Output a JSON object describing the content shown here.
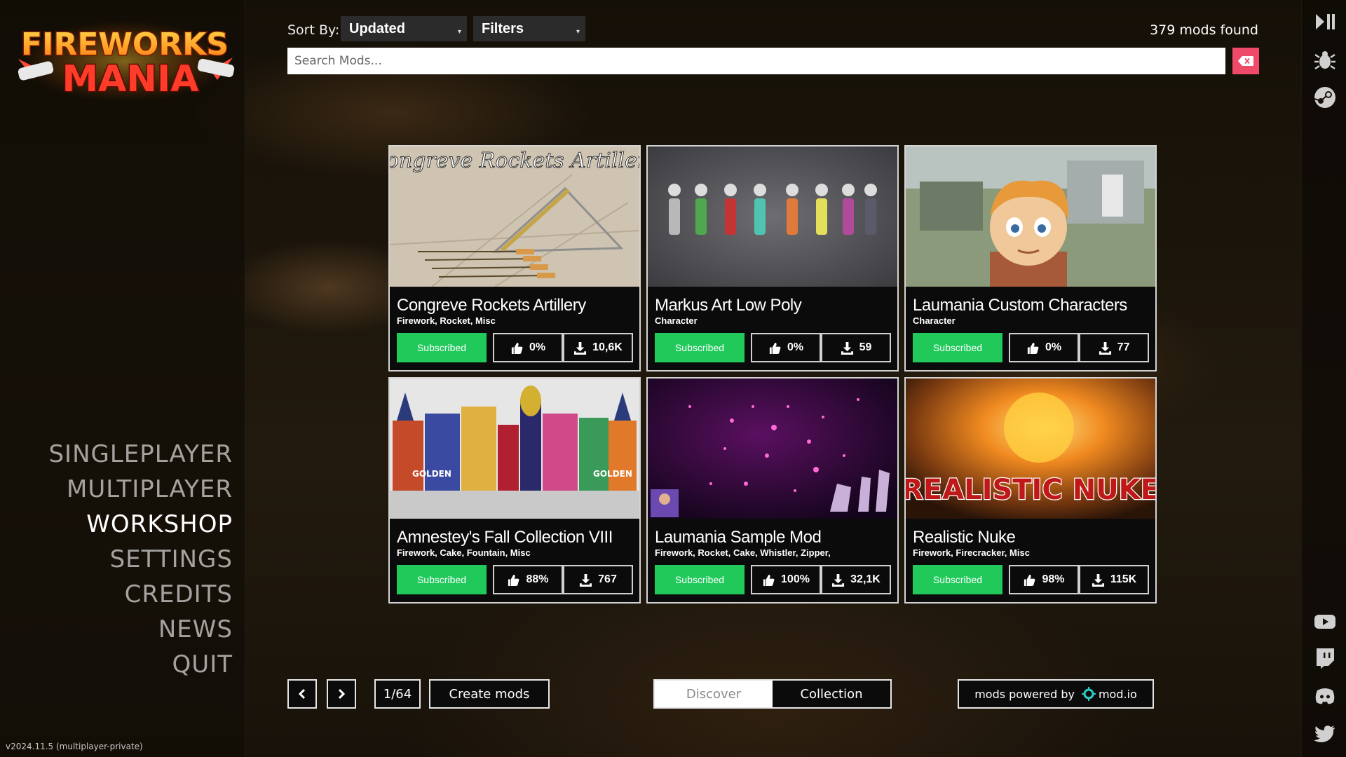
{
  "logo": {
    "line1": "FIREWORKS",
    "line2": "MANIA"
  },
  "sidebar": {
    "menu": [
      {
        "label": "SINGLEPLAYER",
        "active": false
      },
      {
        "label": "MULTIPLAYER",
        "active": false
      },
      {
        "label": "WORKSHOP",
        "active": true
      },
      {
        "label": "SETTINGS",
        "active": false
      },
      {
        "label": "CREDITS",
        "active": false
      },
      {
        "label": "NEWS",
        "active": false
      },
      {
        "label": "QUIT",
        "active": false
      }
    ],
    "version": "v2024.11.5 (multiplayer-private)"
  },
  "toolbar": {
    "sort_label": "Sort By:",
    "sort_value": "Updated",
    "filters_label": "Filters",
    "mods_found": "379 mods found"
  },
  "search": {
    "placeholder": "Search Mods...",
    "value": ""
  },
  "mods": [
    {
      "title": "Congreve Rockets Artillery",
      "tags": "Firework, Rocket, Misc",
      "status": "Subscribed",
      "rating": "0%",
      "downloads": "10,6K",
      "thumb_text": "Congreve Rockets Artillery"
    },
    {
      "title": "Markus Art Low Poly",
      "tags": "Character",
      "status": "Subscribed",
      "rating": "0%",
      "downloads": "59"
    },
    {
      "title": "Laumania Custom Characters",
      "tags": "Character",
      "status": "Subscribed",
      "rating": "0%",
      "downloads": "77"
    },
    {
      "title": "Amnestey's Fall Collection VIII",
      "tags": "Firework, Cake, Fountain, Misc",
      "status": "Subscribed",
      "rating": "88%",
      "downloads": "767"
    },
    {
      "title": "Laumania Sample Mod",
      "tags": "Firework, Rocket, Cake, Whistler, Zipper,",
      "status": "Subscribed",
      "rating": "100%",
      "downloads": "32,1K"
    },
    {
      "title": "Realistic Nuke",
      "tags": "Firework, Firecracker, Misc",
      "status": "Subscribed",
      "rating": "98%",
      "downloads": "115K",
      "thumb_text": "REALISTIC NUKE"
    }
  ],
  "pagination": {
    "page": "1/64",
    "create_label": "Create mods"
  },
  "view_tabs": {
    "discover": "Discover",
    "collection": "Collection",
    "selected": "Collection"
  },
  "powered_by": {
    "label": "mods powered by",
    "brand": "mod.io"
  },
  "rail_icons": [
    "play-pause-icon",
    "bug-icon",
    "steam-icon",
    "youtube-icon",
    "twitch-icon",
    "discord-icon",
    "twitter-icon"
  ],
  "colors": {
    "subscribed_green": "#21c95b",
    "clear_button": "#f04a6a",
    "accent_orange": "#f5a623"
  }
}
